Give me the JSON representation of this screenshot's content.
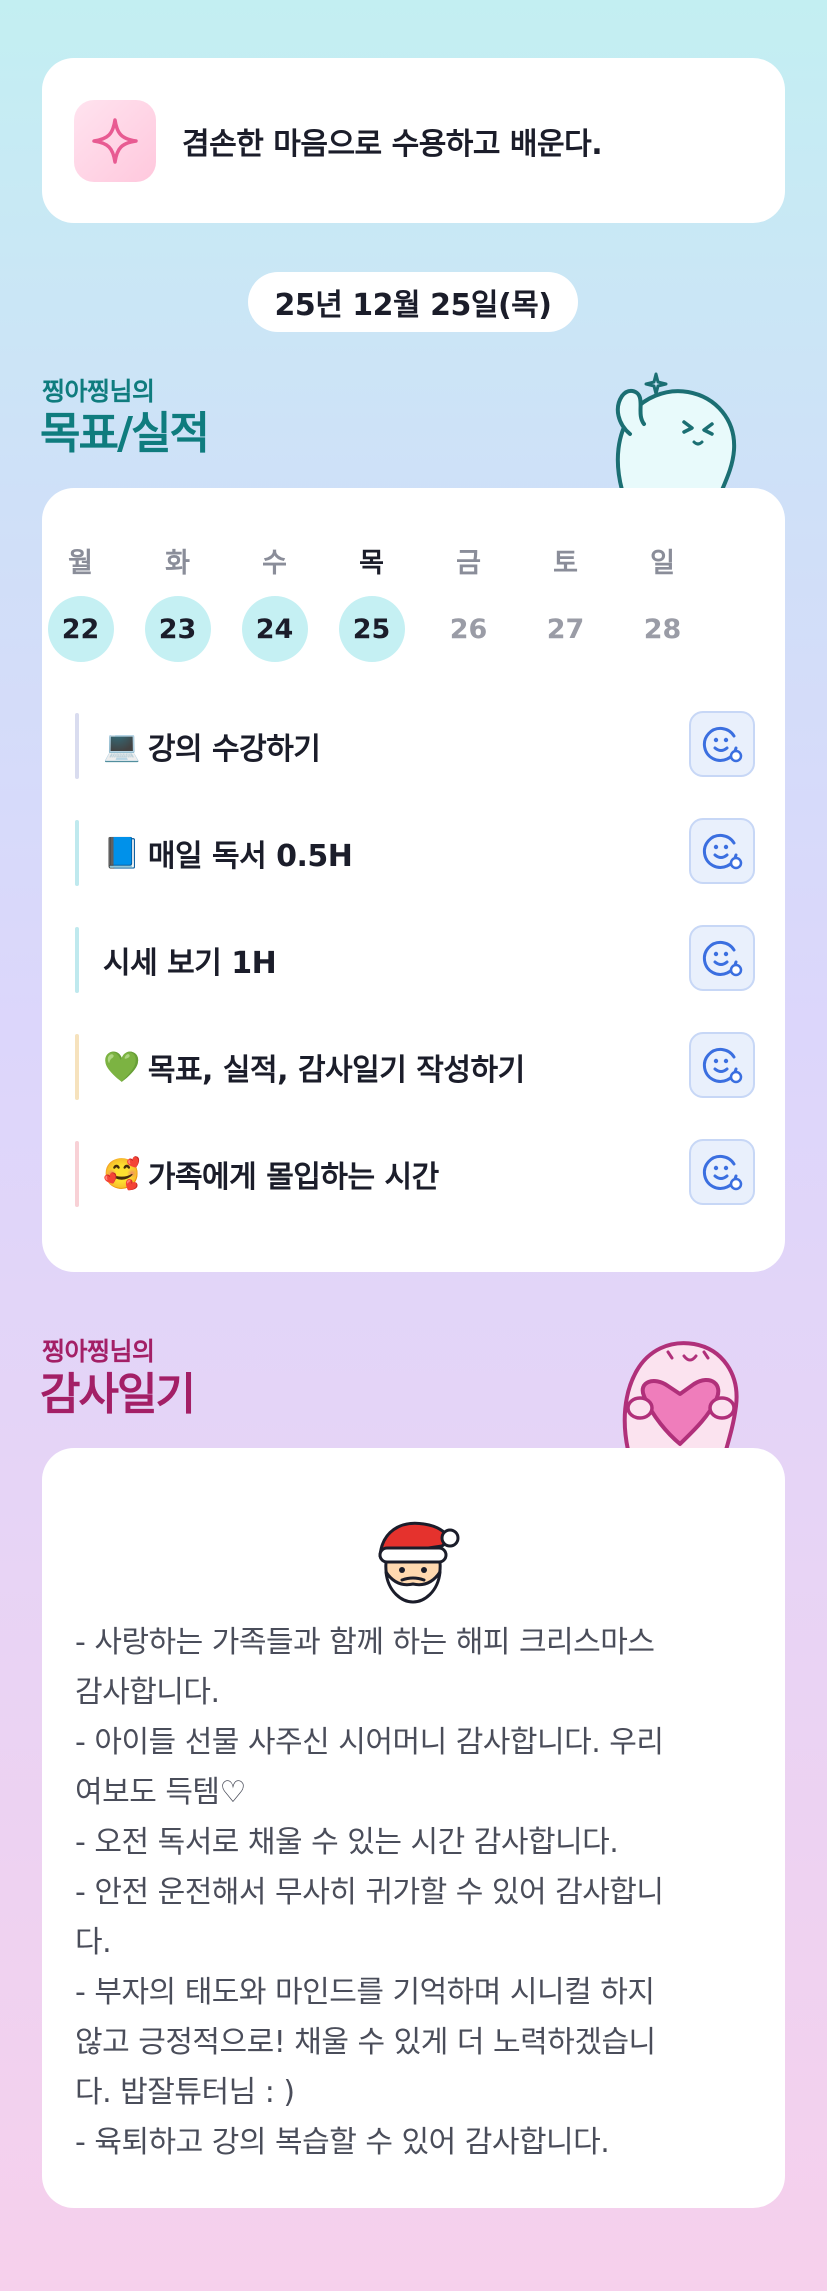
{
  "quote": {
    "text": "겸손한 마음으로 수용하고 배운다.",
    "icon": "sparkle-icon"
  },
  "date": "25년 12월 25일(목)",
  "goals": {
    "subtitle": "찡아찡님의",
    "title": "목표/실적",
    "weekdays": [
      "월",
      "화",
      "수",
      "목",
      "금",
      "토",
      "일"
    ],
    "dates": [
      "22",
      "23",
      "24",
      "25",
      "26",
      "27",
      "28"
    ],
    "done_count": 4,
    "tasks": [
      {
        "emoji": "💻",
        "label": "강의 수강하기",
        "bar_color": "#d9dcef"
      },
      {
        "emoji": "📘",
        "label": "매일 독서 0.5H",
        "bar_color": "#bfe9ee"
      },
      {
        "emoji": "",
        "label": "시세 보기 1H",
        "bar_color": "#bfe9ee"
      },
      {
        "emoji": "💚",
        "label": "목표, 실적, 감사일기 작성하기",
        "bar_color": "#f6e2bd"
      },
      {
        "emoji": "🥰",
        "label": "가족에게 몰입하는 시간",
        "bar_color": "#f8d1d6"
      }
    ],
    "task_button_icon": "smiley-plus-icon"
  },
  "gratitude": {
    "subtitle": "찡아찡님의",
    "title": "감사일기",
    "emoji": "santa-icon",
    "lines": [
      "- 사랑하는 가족들과 함께 하는 해피 크리스마스",
      "감사합니다.",
      "- 아이들 선물 사주신 시어머니 감사합니다. 우리",
      "여보도 득템♡",
      "- 오전 독서로 채울 수 있는 시간 감사합니다.",
      "- 안전 운전해서 무사히 귀가할 수 있어 감사합니",
      "다.",
      "- 부자의 태도와 마인드를 기억하며 시니컬 하지",
      "않고 긍정적으로! 채울 수 있게 더 노력하겠습니",
      "다. 밥잘튜터님 : )",
      "- 육퇴하고 강의 복습할 수 있어 감사합니다."
    ]
  },
  "colors": {
    "goals_title": "#0f7c7e",
    "gratitude_title": "#a31f66",
    "done_circle": "#c5f0f3"
  }
}
